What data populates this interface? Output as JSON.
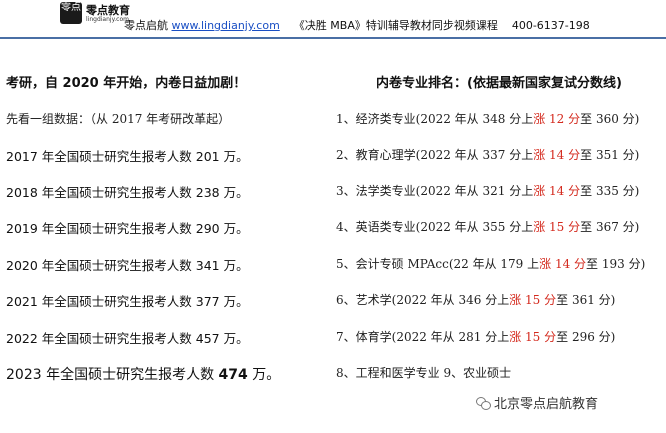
{
  "header": {
    "logo_glyph": "零点",
    "brand": "零点教育",
    "brand_url": "lingdianjy.com",
    "org": "零点启航",
    "link": "www.lingdianjy.com",
    "course": "《决胜 MBA》特训辅导教材同步视频课程",
    "phone": "400-6137-198"
  },
  "left_title": "考研，自 2020 年开始，内卷日益加剧！",
  "right_title": "内卷专业排名：(依据最新国家复试分数线)",
  "intro": "先看一组数据：（从 2017 年考研改革起）",
  "stats": [
    {
      "year": "2017",
      "text": " 年全国硕士研究生报考人数 ",
      "num": "201",
      "unit": " 万。"
    },
    {
      "year": "2018",
      "text": " 年全国硕士研究生报考人数 ",
      "num": "238",
      "unit": " 万。"
    },
    {
      "year": "2019",
      "text": " 年全国硕士研究生报考人数 ",
      "num": "290",
      "unit": " 万。"
    },
    {
      "year": "2020",
      "text": " 年全国硕士研究生报考人数 ",
      "num": "341",
      "unit": " 万。"
    },
    {
      "year": "2021",
      "text": " 年全国硕士研究生报考人数 ",
      "num": "377",
      "unit": " 万。"
    },
    {
      "year": "2022",
      "text": " 年全国硕士研究生报考人数 ",
      "num": "457",
      "unit": " 万。"
    },
    {
      "year": "2023",
      "text": " 年全国硕士研究生报考人数 ",
      "num": "474",
      "unit": " 万。"
    }
  ],
  "rankings": [
    {
      "pre": "1、经济类专业(2022 年从 348 分上",
      "hl": "涨 12 分",
      "post": "至 360 分)"
    },
    {
      "pre": "2、教育心理学(2022 年从 337 分上",
      "hl": "涨 14 分",
      "post": "至 351 分)"
    },
    {
      "pre": "3、法学类专业(2022 年从 321 分上",
      "hl": "涨 14 分",
      "post": "至 335 分)"
    },
    {
      "pre": "4、英语类专业(2022 年从 355 分上",
      "hl": "涨 15 分",
      "post": "至 367 分)"
    },
    {
      "pre": "5、会计专硕 MPAcc(22 年从 179 上",
      "hl": "涨 14 分",
      "post": "至 193 分)"
    },
    {
      "pre": "6、艺术学(2022 年从 346 分上",
      "hl": "涨 15 分",
      "post": "至 361 分)"
    },
    {
      "pre": "7、体育学(2022 年从 281 分上",
      "hl": "涨 15 分",
      "post": "至 296 分)"
    },
    {
      "pre": "8、工程和医学专业    9、农业硕士",
      "hl": "",
      "post": ""
    }
  ],
  "footer": "北京零点启航教育",
  "colors": {
    "highlight": "#d42a1e",
    "link": "#1a4fc4"
  }
}
